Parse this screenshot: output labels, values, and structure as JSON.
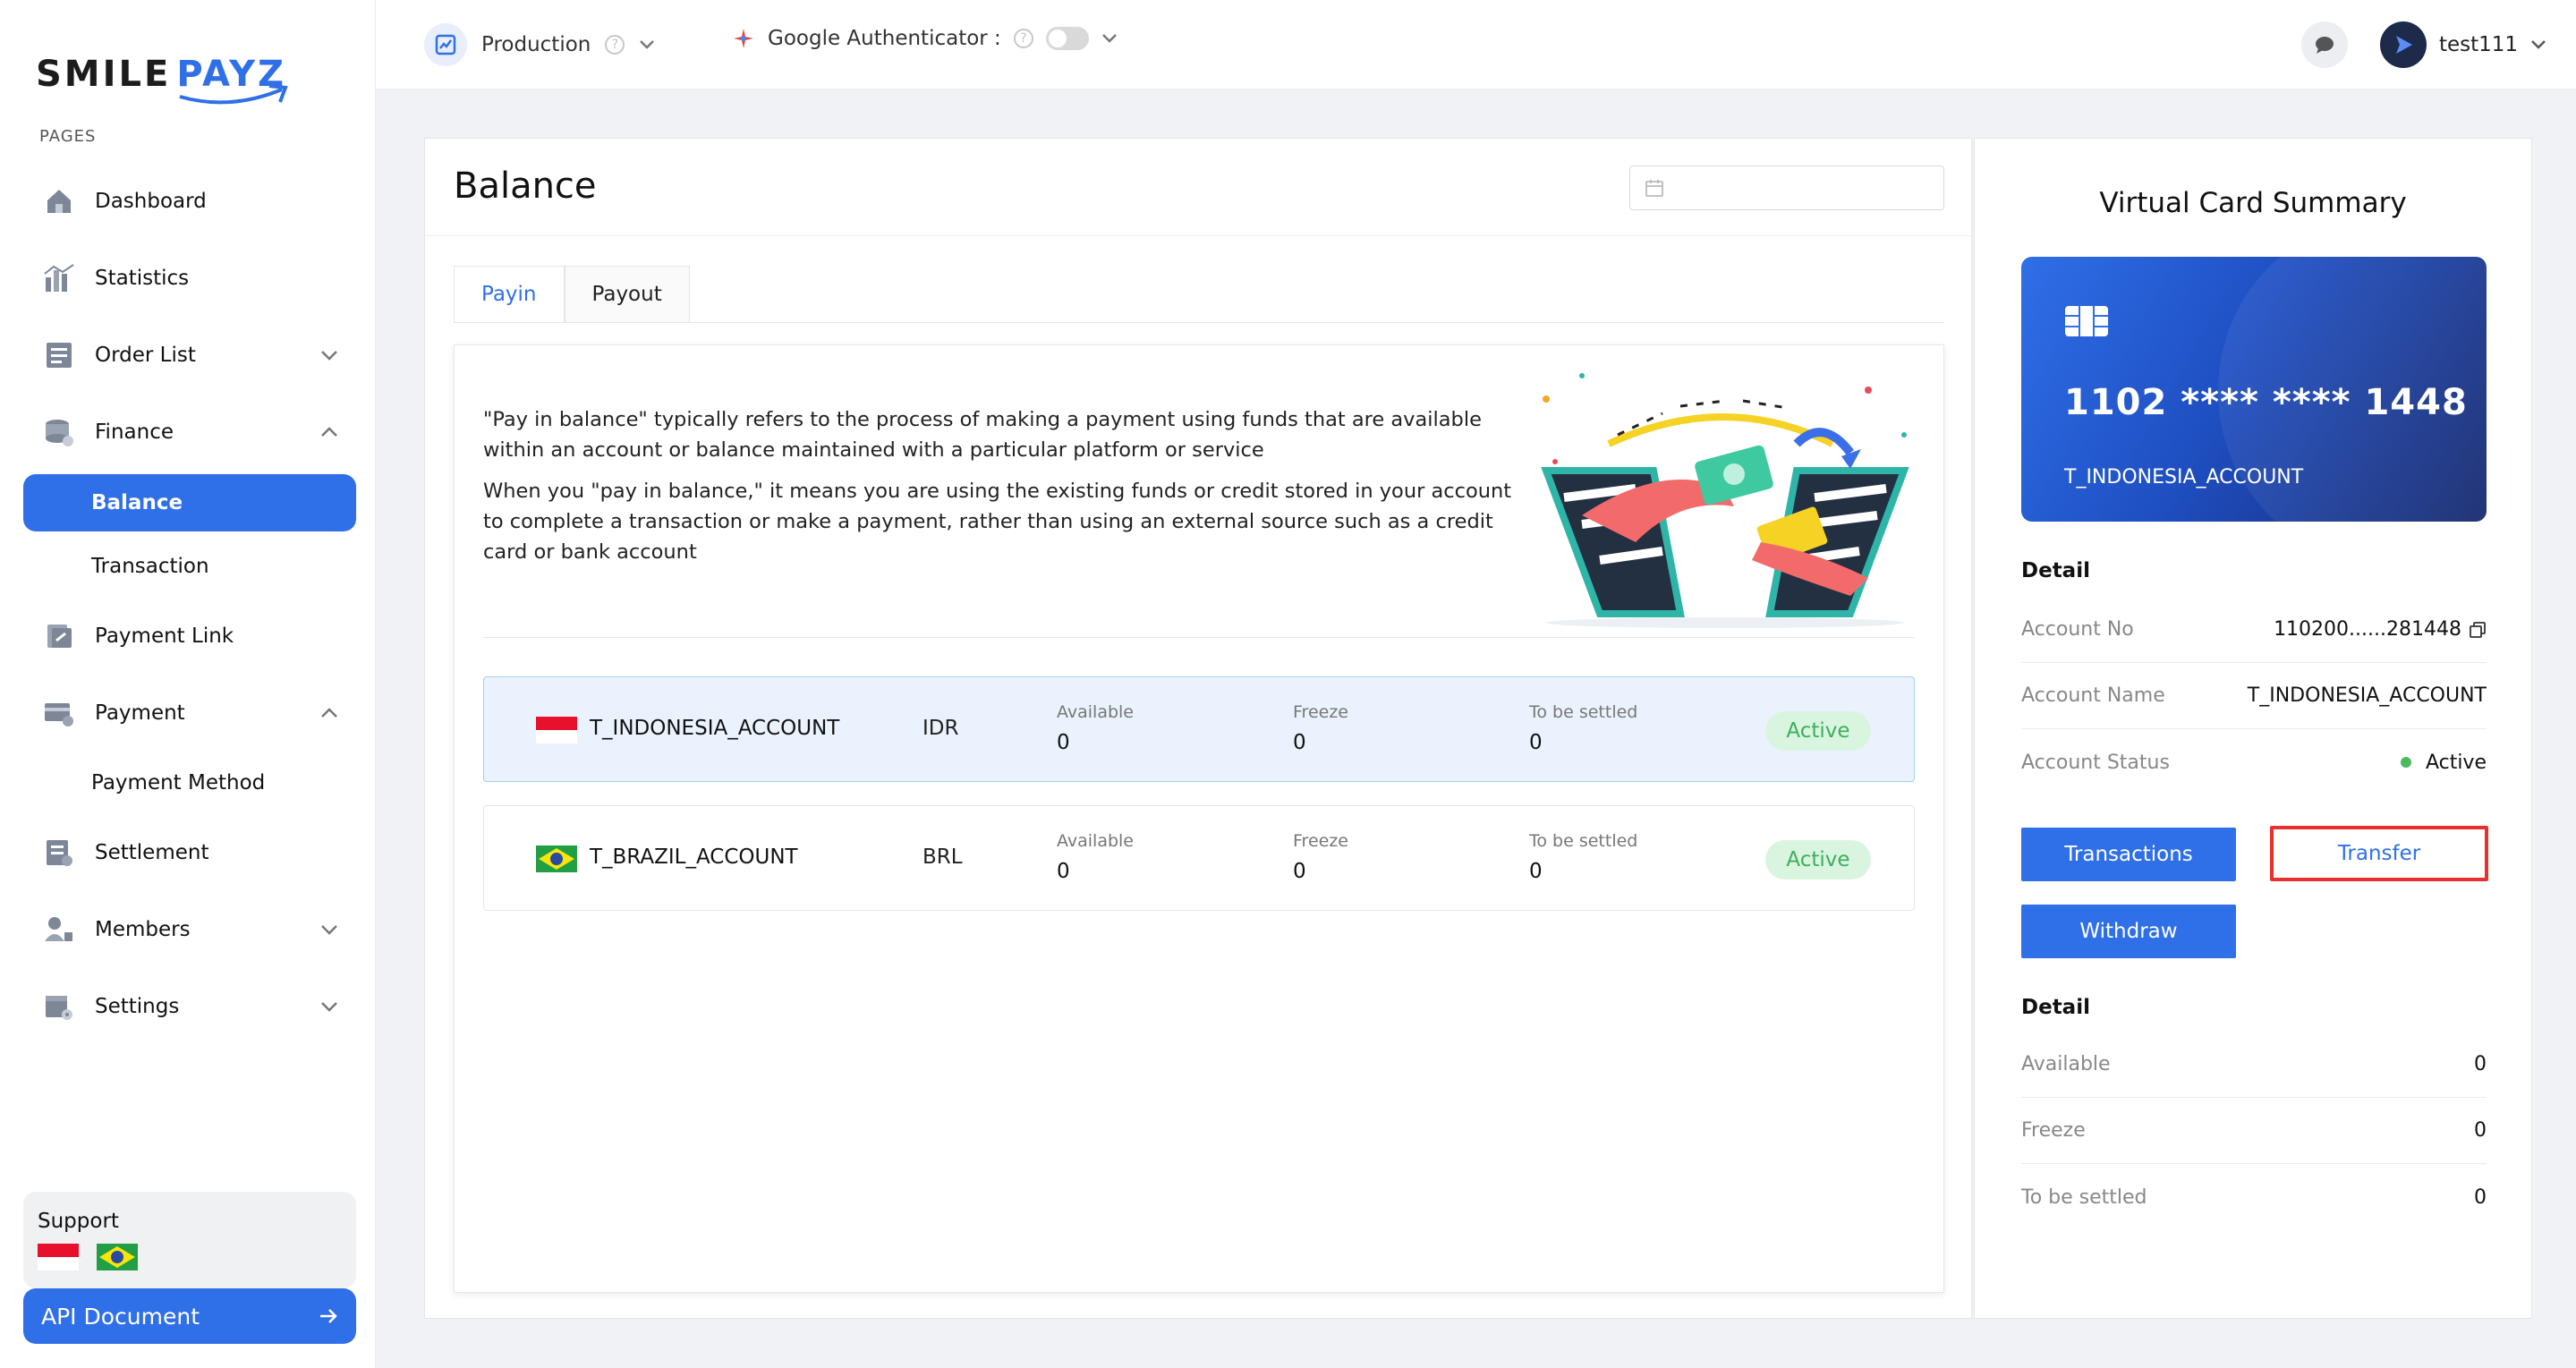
{
  "brand": {
    "part1": "SMILE",
    "part2": "PAYZ"
  },
  "sidebar": {
    "section_label": "PAGES",
    "items": [
      {
        "label": "Dashboard"
      },
      {
        "label": "Statistics"
      },
      {
        "label": "Order List"
      },
      {
        "label": "Finance"
      },
      {
        "label": "Balance"
      },
      {
        "label": "Transaction"
      },
      {
        "label": "Payment Link"
      },
      {
        "label": "Payment"
      },
      {
        "label": "Payment Method"
      },
      {
        "label": "Settlement"
      },
      {
        "label": "Members"
      },
      {
        "label": "Settings"
      }
    ],
    "support_label": "Support",
    "api_button": "API Document"
  },
  "topbar": {
    "environment": "Production",
    "authenticator_label": "Google Authenticator :",
    "username": "test111"
  },
  "main": {
    "title": "Balance",
    "date_placeholder": "",
    "tabs": [
      {
        "label": "Payin"
      },
      {
        "label": "Payout"
      }
    ],
    "description": [
      "\"Pay in balance\" typically refers to the process of making a payment using funds that are available within an account or balance maintained with a particular platform or service",
      "When you \"pay in balance,\" it means you are using the existing funds or credit stored in your account to complete a transaction or make a payment, rather than using an external source such as a credit card or bank account"
    ],
    "column_labels": {
      "available": "Available",
      "freeze": "Freeze",
      "settled": "To be settled"
    },
    "accounts": [
      {
        "name": "T_INDONESIA_ACCOUNT",
        "currency": "IDR",
        "available": "0",
        "freeze": "0",
        "settled": "0",
        "status": "Active"
      },
      {
        "name": "T_BRAZIL_ACCOUNT",
        "currency": "BRL",
        "available": "0",
        "freeze": "0",
        "settled": "0",
        "status": "Active"
      }
    ]
  },
  "summary": {
    "title": "Virtual Card Summary",
    "card_number": "1102 **** **** 1448",
    "card_name": "T_INDONESIA_ACCOUNT",
    "detail_label": "Detail",
    "details": [
      {
        "key": "Account No",
        "value": "110200......281448"
      },
      {
        "key": "Account Name",
        "value": "T_INDONESIA_ACCOUNT"
      },
      {
        "key": "Account Status",
        "value": "Active"
      }
    ],
    "buttons": {
      "transactions": "Transactions",
      "transfer": "Transfer",
      "withdraw": "Withdraw"
    },
    "detail2_label": "Detail",
    "balances": [
      {
        "key": "Available",
        "value": "0"
      },
      {
        "key": "Freeze",
        "value": "0"
      },
      {
        "key": "To be settled",
        "value": "0"
      }
    ]
  },
  "colors": {
    "accent": "#2f6fe8",
    "active_green": "#3cae5c",
    "highlight_red": "#e8312f"
  }
}
